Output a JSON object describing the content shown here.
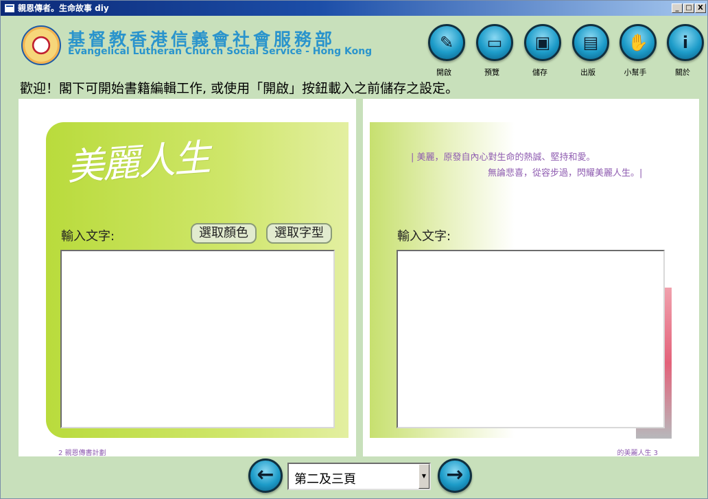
{
  "window": {
    "title": "親恩傳者。生命故事 diy",
    "controls": {
      "minimize": "_",
      "maximize": "□",
      "close": "X"
    }
  },
  "header": {
    "org_name_cn": "基督教香港信義會社會服務部",
    "org_name_en": "Evangelical Lutheran Church Social Service - Hong Kong"
  },
  "toolbar": [
    {
      "id": "open",
      "label": "開啟",
      "icon": "pencil-icon",
      "glyph": "✎"
    },
    {
      "id": "preview",
      "label": "預覽",
      "icon": "monitor-icon",
      "glyph": "▭"
    },
    {
      "id": "save",
      "label": "儲存",
      "icon": "floppy-disk-icon",
      "glyph": "▣"
    },
    {
      "id": "publish",
      "label": "出版",
      "icon": "printer-icon",
      "glyph": "▤"
    },
    {
      "id": "helper",
      "label": "小幫手",
      "icon": "hand-icon",
      "glyph": "✋"
    },
    {
      "id": "about",
      "label": "關於",
      "icon": "info-icon",
      "glyph": "i"
    }
  ],
  "welcome_text": "歡迎！閣下可開始書籍編輯工作, 或使用「開啟」按鈕載入之前儲存之設定。",
  "left_page": {
    "title_art": "美麗人生",
    "input_label": "輸入文字:",
    "choose_color": "選取顏色",
    "choose_font": "選取字型",
    "footer": "2  親恩傳書計劃"
  },
  "right_page": {
    "poem_line1": "| 美麗，原發自內心對生命的熱誠、堅持和愛。",
    "poem_line2": "無論悲喜，從容步過，閃耀美麗人生。|",
    "input_label": "輸入文字:",
    "footer": "的美麗人生  3"
  },
  "nav": {
    "prev_glyph": "←",
    "next_glyph": "→",
    "page_select": "第二及三頁",
    "dropdown_glyph": "▼"
  },
  "colors": {
    "background": "#c8e0bb",
    "accent_blue": "#2a94cc",
    "panel_green": "#c1de4b",
    "poem_purple": "#8e5bb0"
  }
}
